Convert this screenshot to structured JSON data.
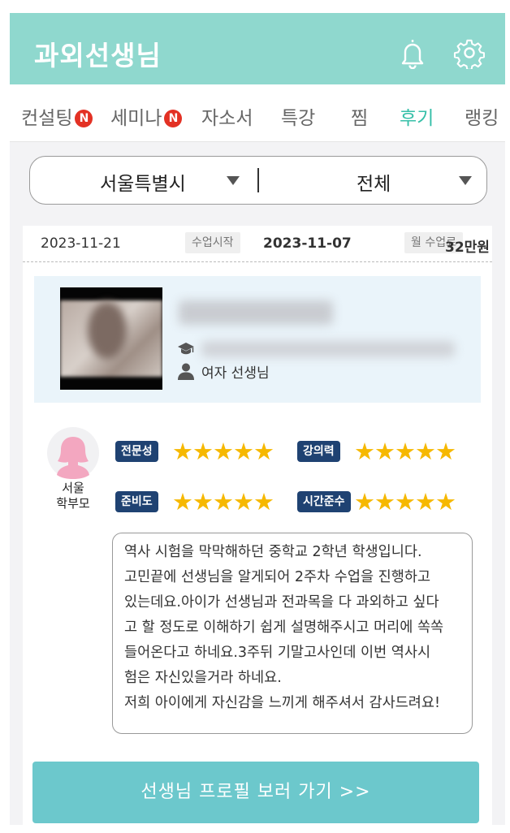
{
  "header": {
    "title": "과외선생님",
    "bell_icon": "bell-icon",
    "settings_icon": "gear-icon"
  },
  "tabs": [
    {
      "label": "컨설팅",
      "badge": "N"
    },
    {
      "label": "세미나",
      "badge": "N"
    },
    {
      "label": "자소서"
    },
    {
      "label": "특강"
    },
    {
      "label": "찜"
    },
    {
      "label": "후기",
      "active": true
    },
    {
      "label": "랭킹"
    }
  ],
  "filters": {
    "region": "서울특별시",
    "category": "전체"
  },
  "review": {
    "date": "2023-11-21",
    "start_label": "수업시작",
    "start_date": "2023-11-07",
    "fee_label": "월 수업료",
    "fee": "32만원",
    "teacher_gender": "여자 선생님",
    "reviewer_region": "서울",
    "reviewer_role": "학부모",
    "ratings": [
      {
        "label": "전문성",
        "stars": "★★★★★",
        "value": 5
      },
      {
        "label": "강의력",
        "stars": "★★★★★",
        "value": 5
      },
      {
        "label": "준비도",
        "stars": "★★★★★",
        "value": 5
      },
      {
        "label": "시간준수",
        "stars": "★★★★★",
        "value": 5
      }
    ],
    "text_lines": [
      "역사 시험을 막막해하던 중학교 2학년 학생입니다.",
      "고민끝에 선생님을 알게되어 2주차 수업을 진행하고",
      "있는데요.아이가 선생님과 전과목을 다 과외하고 싶다",
      "고 할 정도로 이해하기 쉽게 설명해주시고 머리에 쏙쏙",
      "들어온다고 하네요.3주뒤 기말고사인데 이번 역사시",
      "험은 자신있을거라 하네요.",
      "저희 아이에게 자신감을 느끼게 해주셔서 감사드려요!"
    ]
  },
  "cta_label": "선생님 프로필 보러 가기 >>",
  "colors": {
    "header_bg": "#8fd8ce",
    "active_tab": "#36bfa8",
    "badge": "#e33124",
    "rating_label_bg": "#1f4272",
    "star": "#f6b800",
    "cta_bg": "#6cc8cc"
  }
}
